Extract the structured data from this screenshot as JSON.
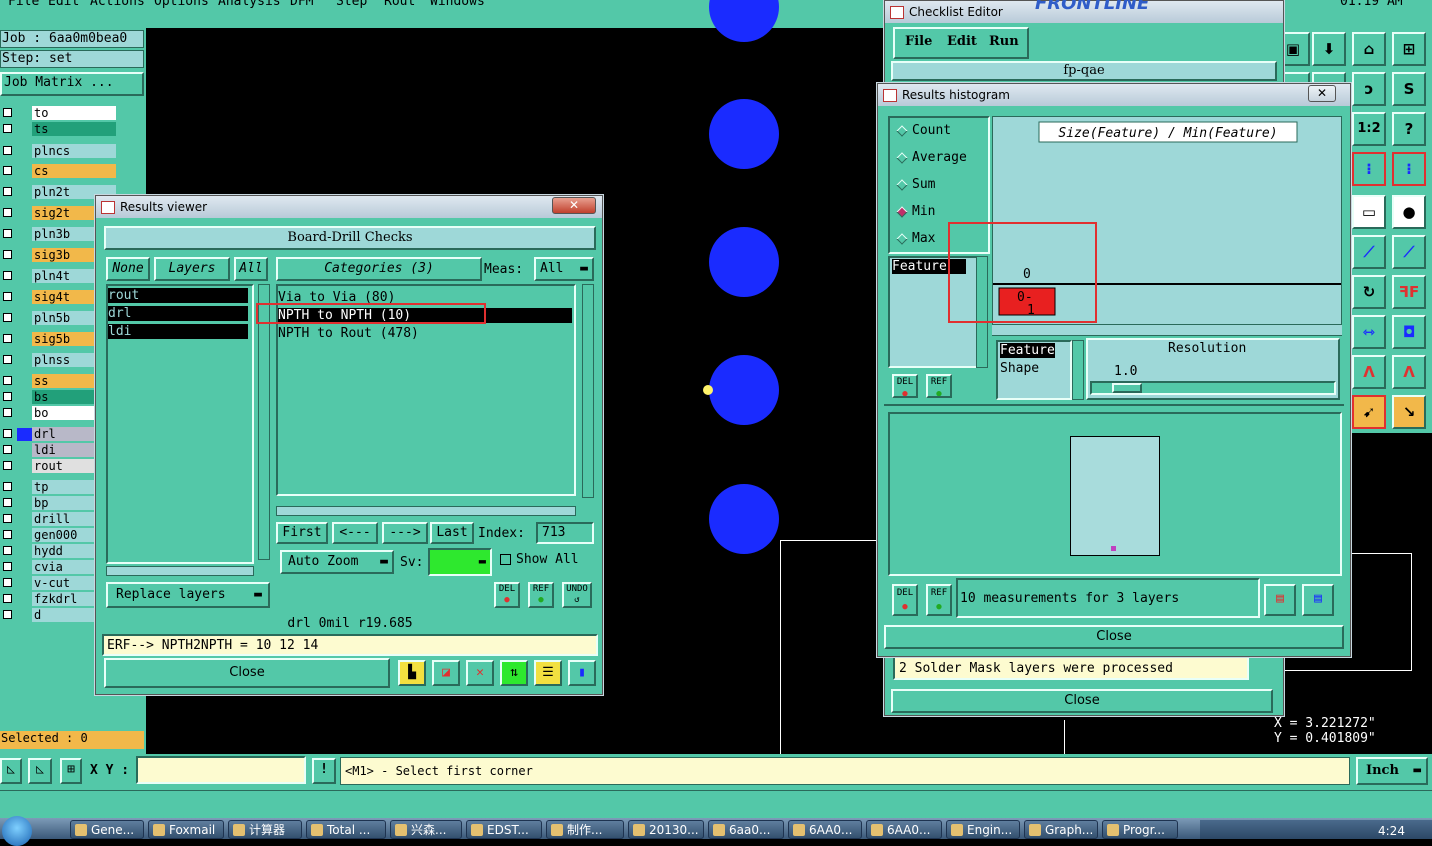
{
  "menubar": {
    "items": [
      "File",
      "Edit",
      "Actions",
      "Options",
      "Analysis",
      "DFM",
      "Step",
      "Rout",
      "Windows"
    ],
    "clock": "01:19 AM"
  },
  "job": {
    "job_label": "Job : 6aa0m0bea0",
    "step_label": "Step: set",
    "matrix_button": "Job Matrix ..."
  },
  "layers": [
    {
      "name": "to",
      "color": "#ffffff"
    },
    {
      "name": "ts",
      "color": "#22a07a"
    },
    {
      "name": "plncs",
      "color": "#9ed8d8"
    },
    {
      "name": "cs",
      "color": "#f2b84a"
    },
    {
      "name": "pln2t",
      "color": "#9ed8d8"
    },
    {
      "name": "sig2t",
      "color": "#f2b84a"
    },
    {
      "name": "pln3b",
      "color": "#9ed8d8"
    },
    {
      "name": "sig3b",
      "color": "#f2b84a"
    },
    {
      "name": "pln4t",
      "color": "#9ed8d8"
    },
    {
      "name": "sig4t",
      "color": "#f2b84a"
    },
    {
      "name": "pln5b",
      "color": "#9ed8d8"
    },
    {
      "name": "sig5b",
      "color": "#f2b84a"
    },
    {
      "name": "plnss",
      "color": "#9ed8d8"
    },
    {
      "name": "ss",
      "color": "#f2b84a"
    },
    {
      "name": "bs",
      "color": "#22a07a"
    },
    {
      "name": "bo",
      "color": "#ffffff"
    },
    {
      "name": "drl",
      "color": "#b8b8c8"
    },
    {
      "name": "ldi",
      "color": "#b8b8c8"
    },
    {
      "name": "rout",
      "color": "#e0e0e0"
    },
    {
      "name": "tp",
      "color": "#9ed8d8"
    },
    {
      "name": "bp",
      "color": "#9ed8d8"
    },
    {
      "name": "drill",
      "color": "#9ed8d8"
    },
    {
      "name": "gen000",
      "color": "#9ed8d8"
    },
    {
      "name": "hydd",
      "color": "#9ed8d8"
    },
    {
      "name": "cvia",
      "color": "#9ed8d8"
    },
    {
      "name": "v-cut",
      "color": "#9ed8d8"
    },
    {
      "name": "fzkdrl",
      "color": "#9ed8d8"
    },
    {
      "name": "d",
      "color": "#9ed8d8"
    }
  ],
  "selected_label": "Selected : 0",
  "results_viewer": {
    "title": "Results viewer",
    "section": "Board-Drill Checks",
    "none_btn": "None",
    "layers_btn": "Layers",
    "all_btn": "All",
    "categories_btn": "Categories (3)",
    "meas_label": "Meas:",
    "meas_value": "All",
    "layer_list": [
      "rout",
      "drl",
      "ldi"
    ],
    "categories": [
      "Via to Via  (80)",
      "NPTH to NPTH  (10)",
      "NPTH to Rout  (478)"
    ],
    "first_btn": "First",
    "prev_btn": "<---",
    "next_btn": "--->",
    "last_btn": "Last",
    "index_label": "Index:",
    "index_value": "713",
    "auto_zoom_btn": "Auto Zoom",
    "sv_label": "Sv:",
    "show_all_label": "Show All",
    "replace_layers_btn": "Replace layers",
    "del_icon": "DEL",
    "ref_icon": "REF",
    "undo_icon": "UNDO",
    "status_text": "drl  0mil  r19.685",
    "erf_text": "ERF--> NPTH2NPTH = 10 12 14",
    "close_btn": "Close"
  },
  "checklist_editor": {
    "title": "Checklist Editor",
    "menu": [
      "File",
      "Edit",
      "Run"
    ],
    "name": "fp-qae",
    "message": "2 Solder Mask layers were processed",
    "close_btn": "Close"
  },
  "histogram": {
    "title": "Results histogram",
    "modes": [
      "Count",
      "Average",
      "Sum",
      "Min",
      "Max"
    ],
    "selected_mode": "Min",
    "chart_title": "Size(Feature) / Min(Feature)",
    "axis_zero": "0",
    "bar_label": "0-",
    "bar_sub": "1",
    "feature_list_item": "Feature",
    "attr_items": [
      "Feature",
      "Shape"
    ],
    "resolution_label": "Resolution",
    "resolution_value": "1.0",
    "del_icon": "DEL",
    "ref_icon": "REF",
    "measurements_text": "10 measurements for 3 layers",
    "close_btn": "Close"
  },
  "coords": {
    "x": "X = 3.221272\"",
    "y": "Y = 0.401809\""
  },
  "bottom": {
    "xy_label": "X Y :",
    "prompt": "<M1> - Select first corner",
    "units": "Inch"
  },
  "taskbar": [
    "Gene...",
    "Foxmail",
    "计算器",
    "Total ...",
    "兴森...",
    "EDST...",
    "制作...",
    "20130...",
    "6aa0...",
    "6AA0...",
    "6AA0...",
    "Engin...",
    "Graph...",
    "Progr..."
  ],
  "tray_clock": "4:24",
  "colors": {
    "panel": "#53c8a8",
    "canvas": "#000000",
    "pad": "#1a2bff",
    "highlight": "#e03030"
  }
}
